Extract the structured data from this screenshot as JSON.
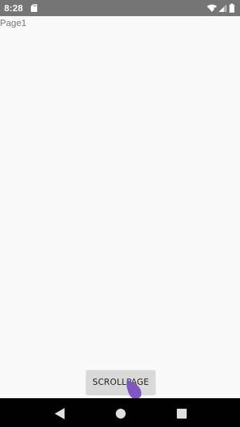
{
  "status_bar": {
    "time": "8:28",
    "icons": [
      "sd-card-icon",
      "wifi-icon",
      "signal-icon",
      "battery-icon"
    ]
  },
  "page": {
    "title": "Page1"
  },
  "button": {
    "label": "SCROLLPAGE"
  },
  "nav_bar": {
    "icons": [
      "back-icon",
      "home-icon",
      "recents-icon"
    ]
  },
  "colors": {
    "status_bar": "#757575",
    "background": "#fafafa",
    "button": "#d9d9d9",
    "touch_indicator": "#7e57c2",
    "nav_bar": "#000000"
  }
}
